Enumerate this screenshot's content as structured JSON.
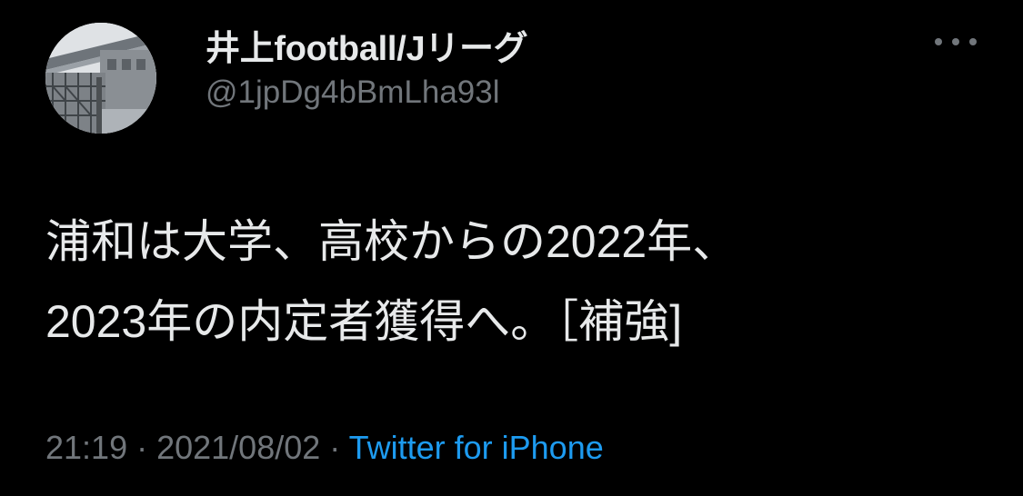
{
  "author": {
    "display_name": "井上football/Jリーグ",
    "handle": "@1jpDg4bBmLha93l"
  },
  "more_icon": "more-horizontal-icon",
  "tweet": {
    "lines": [
      "浦和は大学、高校からの2022年、",
      "2023年の内定者獲得へ。［補強]"
    ]
  },
  "meta": {
    "time": "21:19",
    "separator1": " · ",
    "date": "2021/08/02",
    "separator2": " · ",
    "source": "Twitter for iPhone"
  },
  "colors": {
    "background": "#000000",
    "primary_text": "#e7e9ea",
    "secondary_text": "#71767b",
    "link": "#1d9bf0"
  }
}
